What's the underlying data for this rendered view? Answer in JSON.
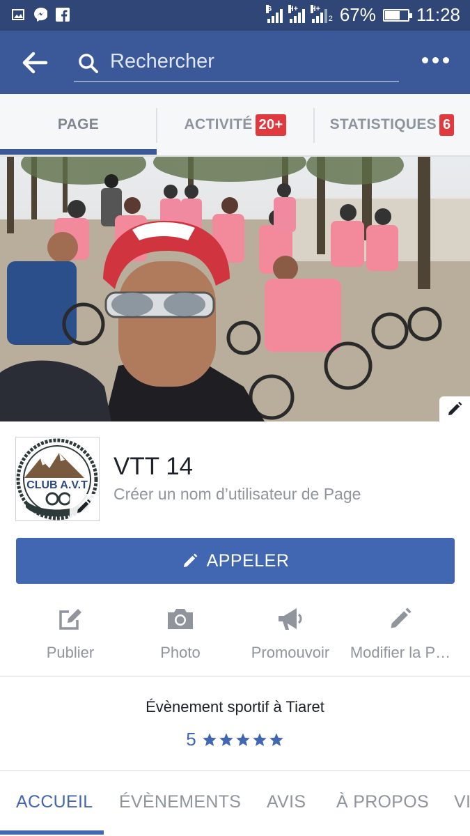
{
  "status_bar": {
    "battery": "67%",
    "battery_level": 0.67,
    "time": "11:28",
    "net1": "G",
    "net2": "H+",
    "net3": "H+",
    "sim2": "2"
  },
  "search": {
    "placeholder": "Rechercher"
  },
  "tabs": [
    {
      "label": "PAGE",
      "badge": ""
    },
    {
      "label": "ACTIVITÉ",
      "badge": "20+"
    },
    {
      "label": "STATISTIQUES",
      "badge": "6"
    }
  ],
  "page": {
    "name": "VTT 14",
    "username_prompt": "Créer un nom d’utilisateur de Page",
    "logo_text": "CLUB A.V.T",
    "call_label": "APPELER",
    "category": "Évènement sportif à Tiaret",
    "rating_value": "5",
    "rating_stars": 5
  },
  "actions": [
    {
      "label": "Publier",
      "icon": "compose-icon"
    },
    {
      "label": "Photo",
      "icon": "camera-icon"
    },
    {
      "label": "Promouvoir",
      "icon": "megaphone-icon"
    },
    {
      "label": "Modifier la P…",
      "icon": "pencil-icon"
    }
  ],
  "bottom_tabs": [
    {
      "label": "ACCUEIL",
      "active": true
    },
    {
      "label": "ÉVÈNEMENTS",
      "active": false
    },
    {
      "label": "AVIS",
      "active": false
    },
    {
      "label": "À PROPOS",
      "active": false
    },
    {
      "label": "VI",
      "active": false
    }
  ],
  "colors": {
    "brand": "#3b5998",
    "button": "#4267b2",
    "badge": "#e0393e",
    "status_bar": "#2f4676"
  }
}
